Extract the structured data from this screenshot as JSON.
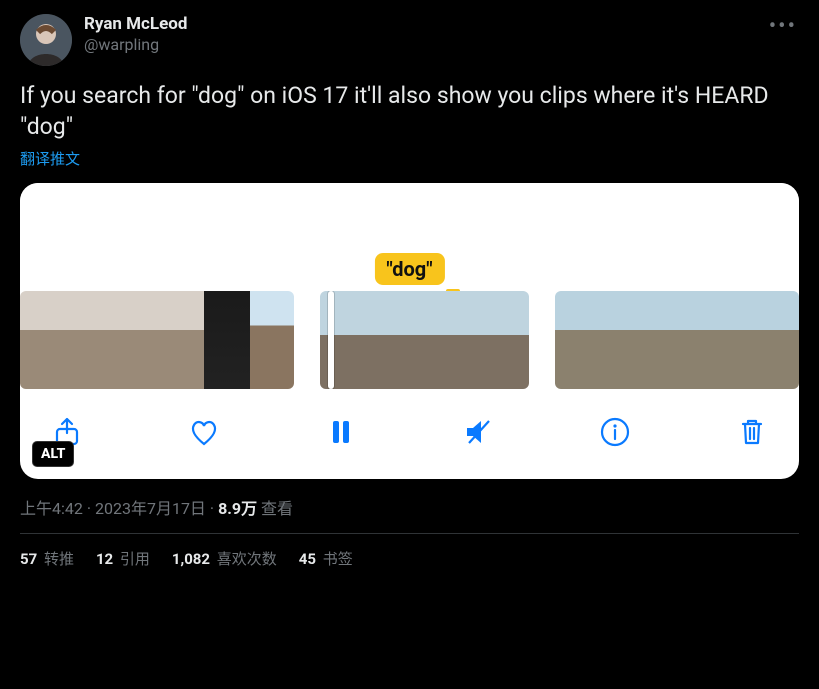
{
  "author": {
    "display_name": "Ryan McLeod",
    "handle": "@warpling"
  },
  "tweet_text": "If you search for \"dog\" on iOS 17 it'll also show you clips where it's HEARD \"dog\"",
  "translate_label": "翻译推文",
  "media": {
    "badge_text": "\"dog\"",
    "alt_badge": "ALT"
  },
  "meta": {
    "time": "上午4:42",
    "dot1": " · ",
    "date": "2023年7月17日",
    "dot2": " · ",
    "views_count": "8.9万",
    "views_label": " 查看"
  },
  "stats": {
    "retweets_count": "57",
    "retweets_label": " 转推",
    "quotes_count": "12",
    "quotes_label": " 引用",
    "likes_count": "1,082",
    "likes_label": " 喜欢次数",
    "bookmarks_count": "45",
    "bookmarks_label": " 书签"
  }
}
